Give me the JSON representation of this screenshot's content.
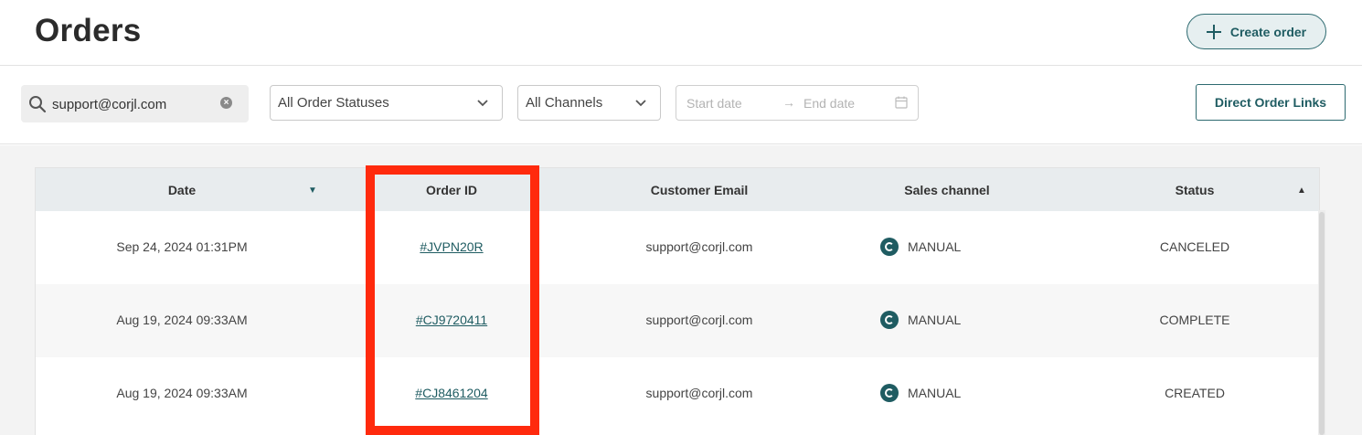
{
  "header": {
    "title": "Orders",
    "create_button_label": "Create order"
  },
  "filters": {
    "search_value": "support@corjl.com",
    "status_select": "All Order Statuses",
    "channel_select": "All Channels",
    "date_start_placeholder": "Start date",
    "date_end_placeholder": "End date",
    "date_arrow": "→",
    "direct_links_label": "Direct Order Links"
  },
  "table": {
    "columns": [
      "Date",
      "Order ID",
      "Customer Email",
      "Sales channel",
      "Status"
    ],
    "rows": [
      {
        "date": "Sep 24, 2024 01:31PM",
        "order_id": "#JVPN20R",
        "email": "support@corjl.com",
        "channel": "MANUAL",
        "status": "CANCELED"
      },
      {
        "date": "Aug 19, 2024 09:33AM",
        "order_id": "#CJ9720411",
        "email": "support@corjl.com",
        "channel": "MANUAL",
        "status": "COMPLETE"
      },
      {
        "date": "Aug 19, 2024 09:33AM",
        "order_id": "#CJ8461204",
        "email": "support@corjl.com",
        "channel": "MANUAL",
        "status": "CREATED"
      }
    ]
  },
  "colors": {
    "accent": "#1f5c62",
    "highlight": "#ff2a0d",
    "header_row_bg": "#e8ecee"
  }
}
